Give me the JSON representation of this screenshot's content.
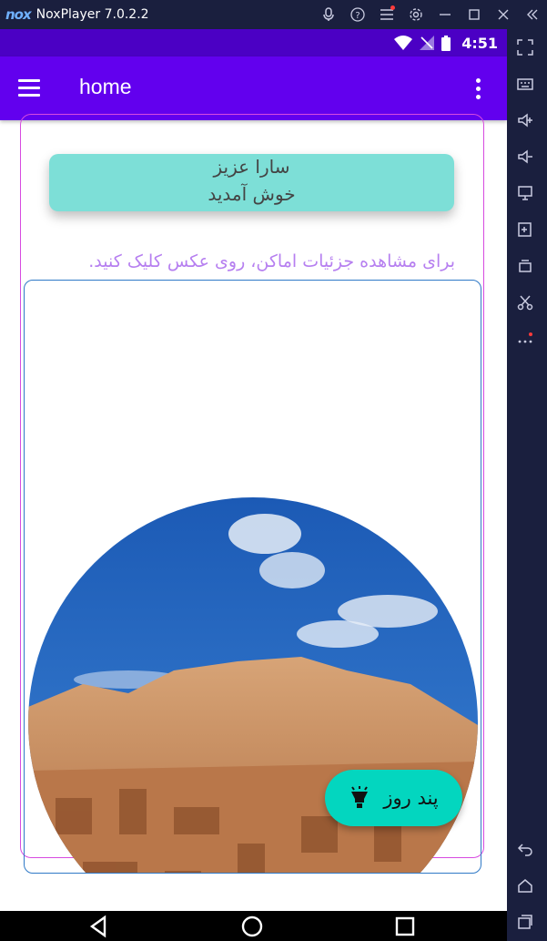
{
  "window": {
    "logo": "nox",
    "title": "NoxPlayer 7.0.2.2",
    "controls": [
      "mic-icon",
      "help-icon",
      "menu-icon",
      "settings-icon",
      "minimize-icon",
      "maximize-icon",
      "close-icon",
      "collapse-icon"
    ]
  },
  "status_bar": {
    "time": "4:51"
  },
  "app_bar": {
    "title": "home"
  },
  "welcome": {
    "line1": "سارا عزیز",
    "line2": "خوش آمدید"
  },
  "hint": "برای مشاهده جزئیات اماکن، روی عکس کلیک کنید.",
  "fab": {
    "label": "پند روز",
    "icon": "lightbulb-icon"
  },
  "colors": {
    "status_bar": "#4b00c4",
    "app_bar": "#6200ee",
    "welcome_bg": "#7ddfd7",
    "hint_text": "#b67ff0",
    "fab_bg": "#03d6bf",
    "outer_border": "#d74ae0",
    "inner_border": "#2f79c7",
    "emulator_chrome": "#1a1f3e"
  },
  "sidebar_icons": [
    "fullscreen-icon",
    "keyboard-icon",
    "volume-up-icon",
    "volume-down-icon",
    "screen-icon",
    "apk-icon",
    "multi-instance-icon",
    "scissors-icon",
    "more-icon",
    "back-icon",
    "home-icon",
    "recents-icon"
  ]
}
